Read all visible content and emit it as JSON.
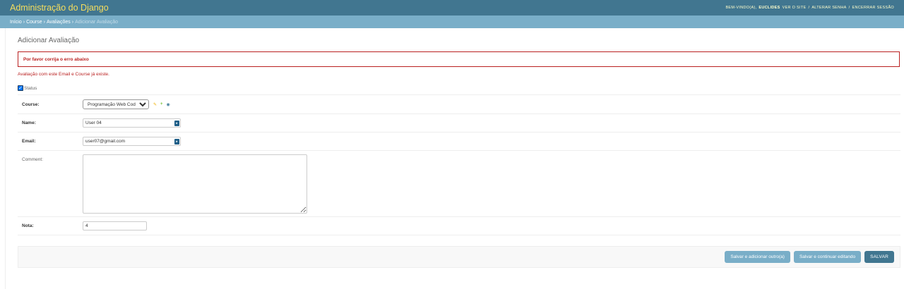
{
  "header": {
    "branding": "Administração do Django",
    "welcome": "BEM-VINDO(A),",
    "username": "EUCLIDES",
    "view_site": "VER O SITE",
    "change_password": "ALTERAR SENHA",
    "logout": "ENCERRAR SESSÃO",
    "sep": "/"
  },
  "breadcrumbs": {
    "home": "Início",
    "app": "Course",
    "model": "Avaliações",
    "current": "Adicionar Avaliação",
    "sep": "›"
  },
  "page": {
    "title": "Adicionar Avaliação",
    "errornote": "Por favor corrija o erro abaixo",
    "error_detail": "Avaliação com este Email e Course já existe."
  },
  "form": {
    "status_label": "Status",
    "status_checked": true,
    "course_label": "Course:",
    "course_value": "Programação Web Coding",
    "name_label": "Name:",
    "name_value": "User 04",
    "email_label": "Email:",
    "email_value": "user07@gmail.com",
    "comment_label": "Comment:",
    "comment_value": "",
    "nota_label": "Nota:",
    "nota_value": "4"
  },
  "icons": {
    "change_related": "pencil-icon",
    "add_related": "plus-icon",
    "view_related": "eye-icon",
    "password_manager": "password-manager-icon"
  },
  "actions": {
    "save_add_another": "Salvar e adicionar outro(a)",
    "save_continue": "Salvar e continuar editando",
    "save": "SALVAR"
  },
  "colors": {
    "header_bg": "#417690",
    "breadcrumbs_bg": "#79aec8",
    "branding": "#f5dd5d",
    "error": "#ba2121",
    "button_primary": "#417690",
    "button_secondary": "#79aec8"
  }
}
